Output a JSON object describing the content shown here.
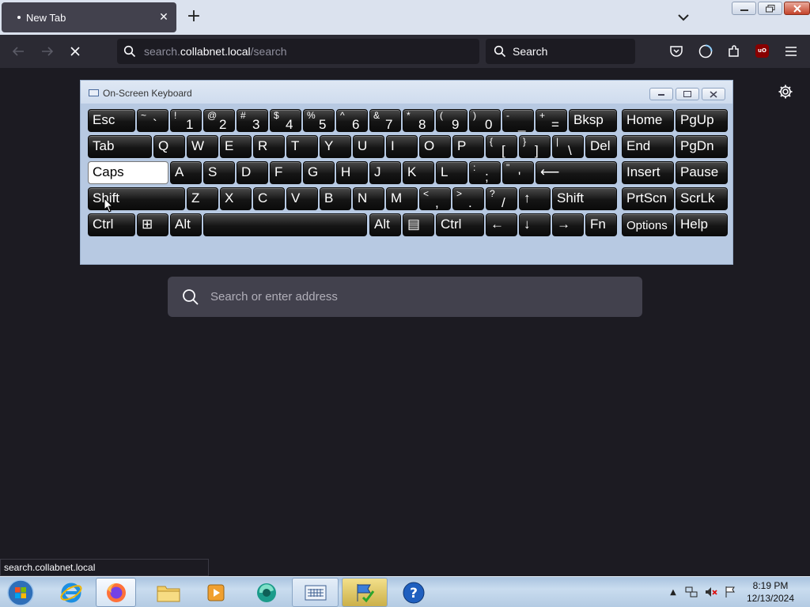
{
  "browser": {
    "tab_title": "New Tab",
    "url_host_prefix": "search.",
    "url_host": "collabnet.local",
    "url_path": "/search",
    "search_placeholder": "Search"
  },
  "page": {
    "search_placeholder": "Search or enter address",
    "status_link": "search.collabnet.local"
  },
  "osk": {
    "title": "On-Screen Keyboard",
    "rows": [
      [
        {
          "label": "Esc"
        },
        {
          "shift": "~",
          "main": "`"
        },
        {
          "shift": "!",
          "main": "1"
        },
        {
          "shift": "@",
          "main": "2"
        },
        {
          "shift": "#",
          "main": "3"
        },
        {
          "shift": "$",
          "main": "4"
        },
        {
          "shift": "%",
          "main": "5"
        },
        {
          "shift": "^",
          "main": "6"
        },
        {
          "shift": "&",
          "main": "7"
        },
        {
          "shift": "*",
          "main": "8"
        },
        {
          "shift": "(",
          "main": "9"
        },
        {
          "shift": ")",
          "main": "0"
        },
        {
          "shift": "-",
          "main": "_"
        },
        {
          "shift": "+",
          "main": "="
        },
        {
          "label": "Bksp"
        },
        {
          "label": "Home"
        },
        {
          "label": "PgUp"
        }
      ],
      [
        {
          "label": "Tab"
        },
        {
          "label": "Q"
        },
        {
          "label": "W"
        },
        {
          "label": "E"
        },
        {
          "label": "R"
        },
        {
          "label": "T"
        },
        {
          "label": "Y"
        },
        {
          "label": "U"
        },
        {
          "label": "I"
        },
        {
          "label": "O"
        },
        {
          "label": "P"
        },
        {
          "shift": "{",
          "main": "["
        },
        {
          "shift": "}",
          "main": "]"
        },
        {
          "shift": "|",
          "main": "\\"
        },
        {
          "label": "Del"
        },
        {
          "label": "End"
        },
        {
          "label": "PgDn"
        }
      ],
      [
        {
          "label": "Caps"
        },
        {
          "label": "A"
        },
        {
          "label": "S"
        },
        {
          "label": "D"
        },
        {
          "label": "F"
        },
        {
          "label": "G"
        },
        {
          "label": "H"
        },
        {
          "label": "J"
        },
        {
          "label": "K"
        },
        {
          "label": "L"
        },
        {
          "shift": ":",
          "main": ";"
        },
        {
          "shift": "\"",
          "main": "'"
        },
        {
          "label": "⟵"
        },
        {
          "label": "Insert"
        },
        {
          "label": "Pause"
        }
      ],
      [
        {
          "label": "Shift"
        },
        {
          "label": "Z"
        },
        {
          "label": "X"
        },
        {
          "label": "C"
        },
        {
          "label": "V"
        },
        {
          "label": "B"
        },
        {
          "label": "N"
        },
        {
          "label": "M"
        },
        {
          "shift": "<",
          "main": ","
        },
        {
          "shift": ">",
          "main": "."
        },
        {
          "shift": "?",
          "main": "/"
        },
        {
          "label": "↑"
        },
        {
          "label": "Shift"
        },
        {
          "label": "PrtScn"
        },
        {
          "label": "ScrLk"
        }
      ],
      [
        {
          "label": "Ctrl"
        },
        {
          "label": "⊞"
        },
        {
          "label": "Alt"
        },
        {
          "label": ""
        },
        {
          "label": "Alt"
        },
        {
          "label": "▤"
        },
        {
          "label": "Ctrl"
        },
        {
          "label": "←"
        },
        {
          "label": "↓"
        },
        {
          "label": "→"
        },
        {
          "label": "Fn"
        },
        {
          "label": "Options"
        },
        {
          "label": "Help"
        }
      ]
    ]
  },
  "taskbar": {
    "time": "8:19 PM",
    "date": "12/13/2024",
    "items": [
      "windows-start",
      "internet-explorer",
      "firefox",
      "file-explorer",
      "media-player",
      "browser-app",
      "on-screen-keyboard",
      "action-center",
      "help"
    ]
  },
  "colors": {
    "page_bg": "#1c1b22",
    "toolbar_bg": "#2b2a33",
    "tabstrip_bg": "#dbe2ee",
    "field_bg": "#42414d",
    "key_bg": "#151515"
  }
}
